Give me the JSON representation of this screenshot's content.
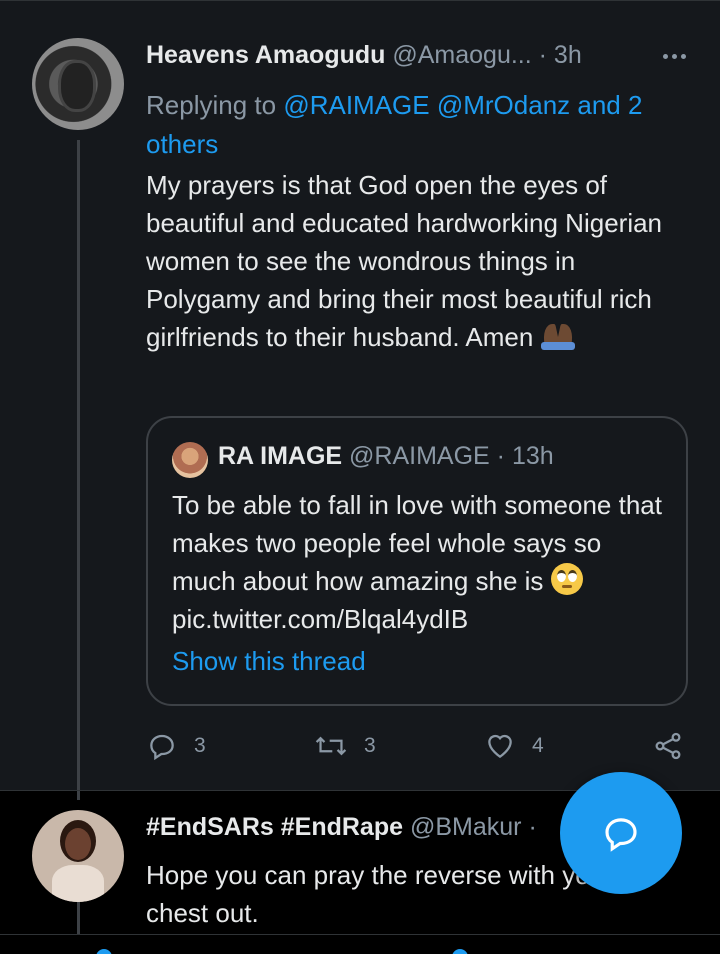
{
  "tweet": {
    "author_name": "Heavens Amaogudu",
    "author_handle": "@Amaogu...",
    "time": "· 3h",
    "replying_prefix": "Replying to ",
    "replying_targets": "@RAIMAGE @MrOdanz and 2 others",
    "body": "My prayers is that God open the eyes of beautiful and educated hardworking Nigerian women to see the wondrous things in Polygamy and bring their most beautiful rich girlfriends to their husband. Amen ",
    "emoji": "folded-hands-icon",
    "quote": {
      "name": "RA IMAGE",
      "handle": "@RAIMAGE",
      "time": "· 13h",
      "body": "To be able to fall in love with someone that makes two people feel whole says so much about how amazing she is ",
      "emoji": "rolling-eyes-icon",
      "link": "pic.twitter.com/Blqal4ydIB",
      "show_thread": "Show this thread"
    },
    "actions": {
      "replies": "3",
      "retweets": "3",
      "likes": "4"
    }
  },
  "reply": {
    "author_name": "#EndSARs #EndRape",
    "author_handle": "@BMakur",
    "time": "·",
    "body": "Hope you can pray the reverse with your chest out."
  },
  "colors": {
    "background": "#000000",
    "card": "#15181c",
    "accent": "#1d9bf0",
    "muted": "#8b98a5",
    "text": "#e7e9ea"
  }
}
